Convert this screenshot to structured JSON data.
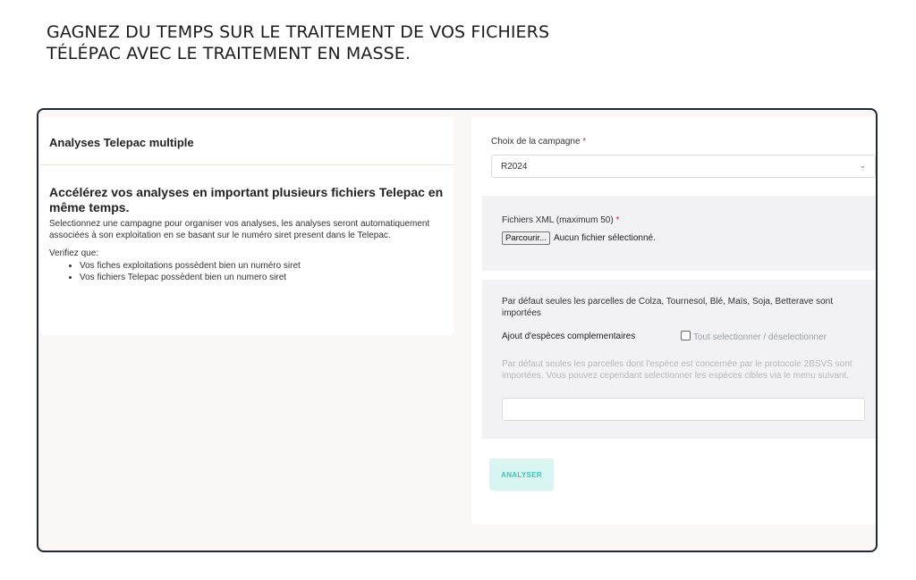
{
  "headline": {
    "line1": "GAGNEZ DU TEMPS SUR LE TRAITEMENT DE VOS FICHIERS",
    "line2": "TÉLÉPAC AVEC LE TRAITEMENT EN MASSE."
  },
  "left_card": {
    "header": "Analyses Telepac multiple",
    "title": "Accélérez vos analyses en important plusieurs fichiers Telepac en même temps.",
    "description": "Selectionnez une campagne pour organiser vos analyses, les analyses seront automatiquement associées à son exploitation en se basant sur le numéro siret present dans le Telepac.",
    "verify_label": "Verifiez que:",
    "checks": [
      "Vos fiches exploitations possèdent bien un numéro siret",
      "Vos fichiers Telepac possèdent bien un numero siret"
    ]
  },
  "form": {
    "campaign_label": "Choix de la campagne",
    "required_mark": "*",
    "campaign_value": "R2024",
    "xml_label": "Fichiers XML (maximum 50)",
    "browse_label": "Parcourir...",
    "no_file_text": "Aucun fichier sélectionné.",
    "default_species_note": "Par défaut seules les parcelles de Colza, Tournesol, Blé, Maïs, Soja, Betterave sont importées",
    "extra_species_label": "Ajout d'espèces complementaires",
    "select_all_label": "Tout selectionner / déselectionner",
    "select_all_checked": false,
    "species_hint": "Par défaut seules les parcelles dont l'espèce est concernée par le protocole 2BSVS sont importées. Vous pouvez cependant selectionner les espèces cibles via le menu suivant.",
    "species_input_value": "",
    "analyze_label": "ANALYSER"
  },
  "icons": {
    "select_arrow": "chevron-down-icon"
  },
  "colors": {
    "frame_border": "#1e2a38",
    "required": "#e11d48",
    "analyze_bg": "#d9f5f1",
    "analyze_text": "#3dc5b8"
  }
}
